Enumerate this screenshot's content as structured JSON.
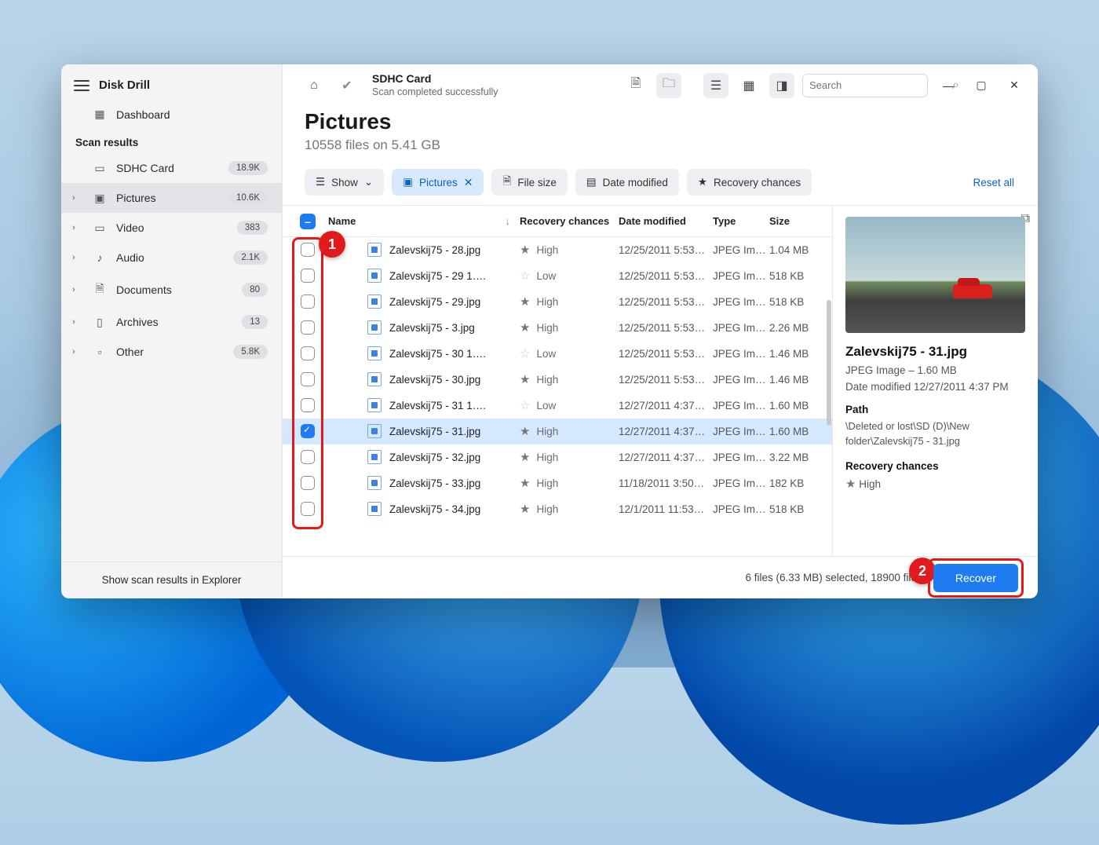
{
  "app": {
    "title": "Disk Drill"
  },
  "sidebar": {
    "dashboard": "Dashboard",
    "section": "Scan results",
    "items": [
      {
        "icon": "drive",
        "label": "SDHC Card",
        "badge": "18.9K",
        "chev": false
      },
      {
        "icon": "image",
        "label": "Pictures",
        "badge": "10.6K",
        "chev": true,
        "active": true
      },
      {
        "icon": "video",
        "label": "Video",
        "badge": "383",
        "chev": true
      },
      {
        "icon": "audio",
        "label": "Audio",
        "badge": "2.1K",
        "chev": true
      },
      {
        "icon": "doc",
        "label": "Documents",
        "badge": "80",
        "chev": true
      },
      {
        "icon": "arch",
        "label": "Archives",
        "badge": "13",
        "chev": true
      },
      {
        "icon": "other",
        "label": "Other",
        "badge": "5.8K",
        "chev": true
      }
    ],
    "footer": "Show scan results in Explorer"
  },
  "topbar": {
    "title": "SDHC Card",
    "subtitle": "Scan completed successfully",
    "search_placeholder": "Search"
  },
  "page": {
    "heading": "Pictures",
    "subheading": "10558 files on 5.41 GB"
  },
  "filters": {
    "show": "Show",
    "pictures": "Pictures",
    "file_size": "File size",
    "date_modified": "Date modified",
    "recovery": "Recovery chances",
    "reset": "Reset all"
  },
  "columns": {
    "name": "Name",
    "recovery": "Recovery chances",
    "date": "Date modified",
    "type": "Type",
    "size": "Size"
  },
  "rows": [
    {
      "name": "Zalevskij75 - 28.jpg",
      "rc": "High",
      "star": true,
      "date": "12/25/2011 5:53…",
      "type": "JPEG Im…",
      "size": "1.04 MB",
      "checked": false
    },
    {
      "name": "Zalevskij75 - 29 1….",
      "rc": "Low",
      "star": false,
      "date": "12/25/2011 5:53…",
      "type": "JPEG Im…",
      "size": "518 KB",
      "checked": false
    },
    {
      "name": "Zalevskij75 - 29.jpg",
      "rc": "High",
      "star": true,
      "date": "12/25/2011 5:53…",
      "type": "JPEG Im…",
      "size": "518 KB",
      "checked": false
    },
    {
      "name": "Zalevskij75 - 3.jpg",
      "rc": "High",
      "star": true,
      "date": "12/25/2011 5:53…",
      "type": "JPEG Im…",
      "size": "2.26 MB",
      "checked": false
    },
    {
      "name": "Zalevskij75 - 30 1….",
      "rc": "Low",
      "star": false,
      "date": "12/25/2011 5:53…",
      "type": "JPEG Im…",
      "size": "1.46 MB",
      "checked": false
    },
    {
      "name": "Zalevskij75 - 30.jpg",
      "rc": "High",
      "star": true,
      "date": "12/25/2011 5:53…",
      "type": "JPEG Im…",
      "size": "1.46 MB",
      "checked": false
    },
    {
      "name": "Zalevskij75 - 31 1….",
      "rc": "Low",
      "star": false,
      "date": "12/27/2011 4:37…",
      "type": "JPEG Im…",
      "size": "1.60 MB",
      "checked": false
    },
    {
      "name": "Zalevskij75 - 31.jpg",
      "rc": "High",
      "star": true,
      "date": "12/27/2011 4:37…",
      "type": "JPEG Im…",
      "size": "1.60 MB",
      "checked": true,
      "selected": true
    },
    {
      "name": "Zalevskij75 - 32.jpg",
      "rc": "High",
      "star": true,
      "date": "12/27/2011 4:37…",
      "type": "JPEG Im…",
      "size": "3.22 MB",
      "checked": false
    },
    {
      "name": "Zalevskij75 - 33.jpg",
      "rc": "High",
      "star": true,
      "date": "11/18/2011 3:50…",
      "type": "JPEG Im…",
      "size": "182 KB",
      "checked": false
    },
    {
      "name": "Zalevskij75 - 34.jpg",
      "rc": "High",
      "star": true,
      "date": "12/1/2011 11:53…",
      "type": "JPEG Im…",
      "size": "518 KB",
      "checked": false
    }
  ],
  "details": {
    "filename": "Zalevskij75 - 31.jpg",
    "meta1": "JPEG Image – 1.60 MB",
    "meta2": "Date modified 12/27/2011 4:37 PM",
    "path_label": "Path",
    "path": "\\Deleted or lost\\SD (D)\\New folder\\Zalevskij75 - 31.jpg",
    "rc_label": "Recovery chances",
    "rc_value": "High"
  },
  "footer": {
    "status": "6 files (6.33 MB) selected, 18900 file",
    "recover": "Recover"
  },
  "annotations": {
    "n1": "1",
    "n2": "2"
  }
}
